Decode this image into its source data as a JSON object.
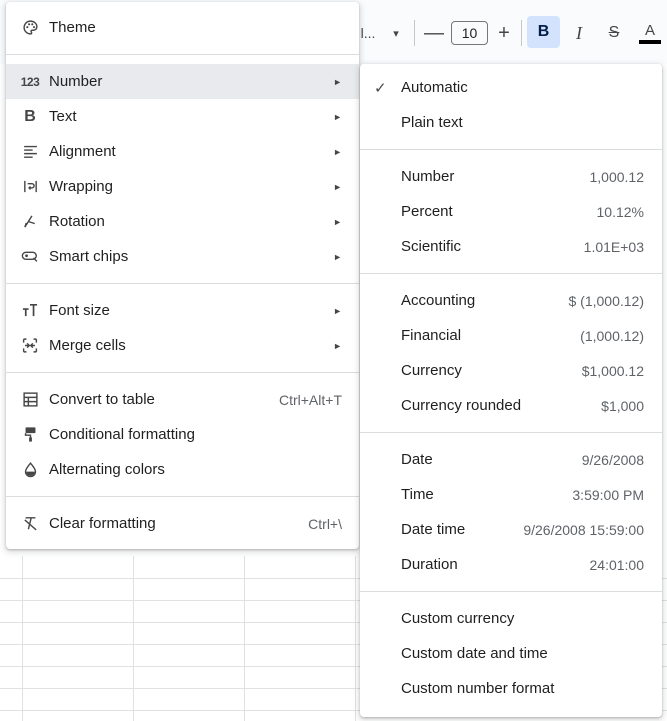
{
  "toolbar": {
    "font_label": "l...",
    "font_caret": "▾",
    "minus": "—",
    "font_size": "10",
    "plus": "+",
    "bold": "B",
    "italic": "I",
    "strike": "S",
    "text_color": "A"
  },
  "menu": {
    "items": [
      {
        "label": "Theme",
        "icon": "palette-icon"
      },
      {
        "label": "Number",
        "icon": "number-format-icon",
        "glyph": "123",
        "arrow": "►"
      },
      {
        "label": "Text",
        "icon": "bold-icon",
        "glyph": "B",
        "arrow": "►"
      },
      {
        "label": "Alignment",
        "icon": "align-left-icon",
        "arrow": "►"
      },
      {
        "label": "Wrapping",
        "icon": "wrap-text-icon",
        "arrow": "►"
      },
      {
        "label": "Rotation",
        "icon": "text-rotation-icon",
        "arrow": "►"
      },
      {
        "label": "Smart chips",
        "icon": "smart-chip-icon",
        "arrow": "►"
      },
      {
        "label": "Font size",
        "icon": "font-size-icon",
        "arrow": "►"
      },
      {
        "label": "Merge cells",
        "icon": "merge-cells-icon",
        "arrow": "►"
      },
      {
        "label": "Convert to table",
        "icon": "table-icon",
        "shortcut": "Ctrl+Alt+T"
      },
      {
        "label": "Conditional formatting",
        "icon": "paint-roller-icon"
      },
      {
        "label": "Alternating colors",
        "icon": "fill-drop-icon"
      },
      {
        "label": "Clear formatting",
        "icon": "clear-format-icon",
        "shortcut": "Ctrl+\\"
      }
    ]
  },
  "submenu": {
    "check": "✓",
    "items": [
      {
        "label": "Automatic",
        "value": ""
      },
      {
        "label": "Plain text",
        "value": ""
      },
      {
        "label": "Number",
        "value": "1,000.12"
      },
      {
        "label": "Percent",
        "value": "10.12%"
      },
      {
        "label": "Scientific",
        "value": "1.01E+03"
      },
      {
        "label": "Accounting",
        "value": "$ (1,000.12)"
      },
      {
        "label": "Financial",
        "value": "(1,000.12)"
      },
      {
        "label": "Currency",
        "value": "$1,000.12"
      },
      {
        "label": "Currency rounded",
        "value": "$1,000"
      },
      {
        "label": "Date",
        "value": "9/26/2008"
      },
      {
        "label": "Time",
        "value": "3:59:00 PM"
      },
      {
        "label": "Date time",
        "value": "9/26/2008 15:59:00"
      },
      {
        "label": "Duration",
        "value": "24:01:00"
      },
      {
        "label": "Custom currency",
        "value": ""
      },
      {
        "label": "Custom date and time",
        "value": ""
      },
      {
        "label": "Custom number format",
        "value": ""
      }
    ]
  },
  "colors": {
    "active_row": "#e8eaed",
    "bold_active": "#d3e3fd",
    "separator": "#dadce0"
  }
}
